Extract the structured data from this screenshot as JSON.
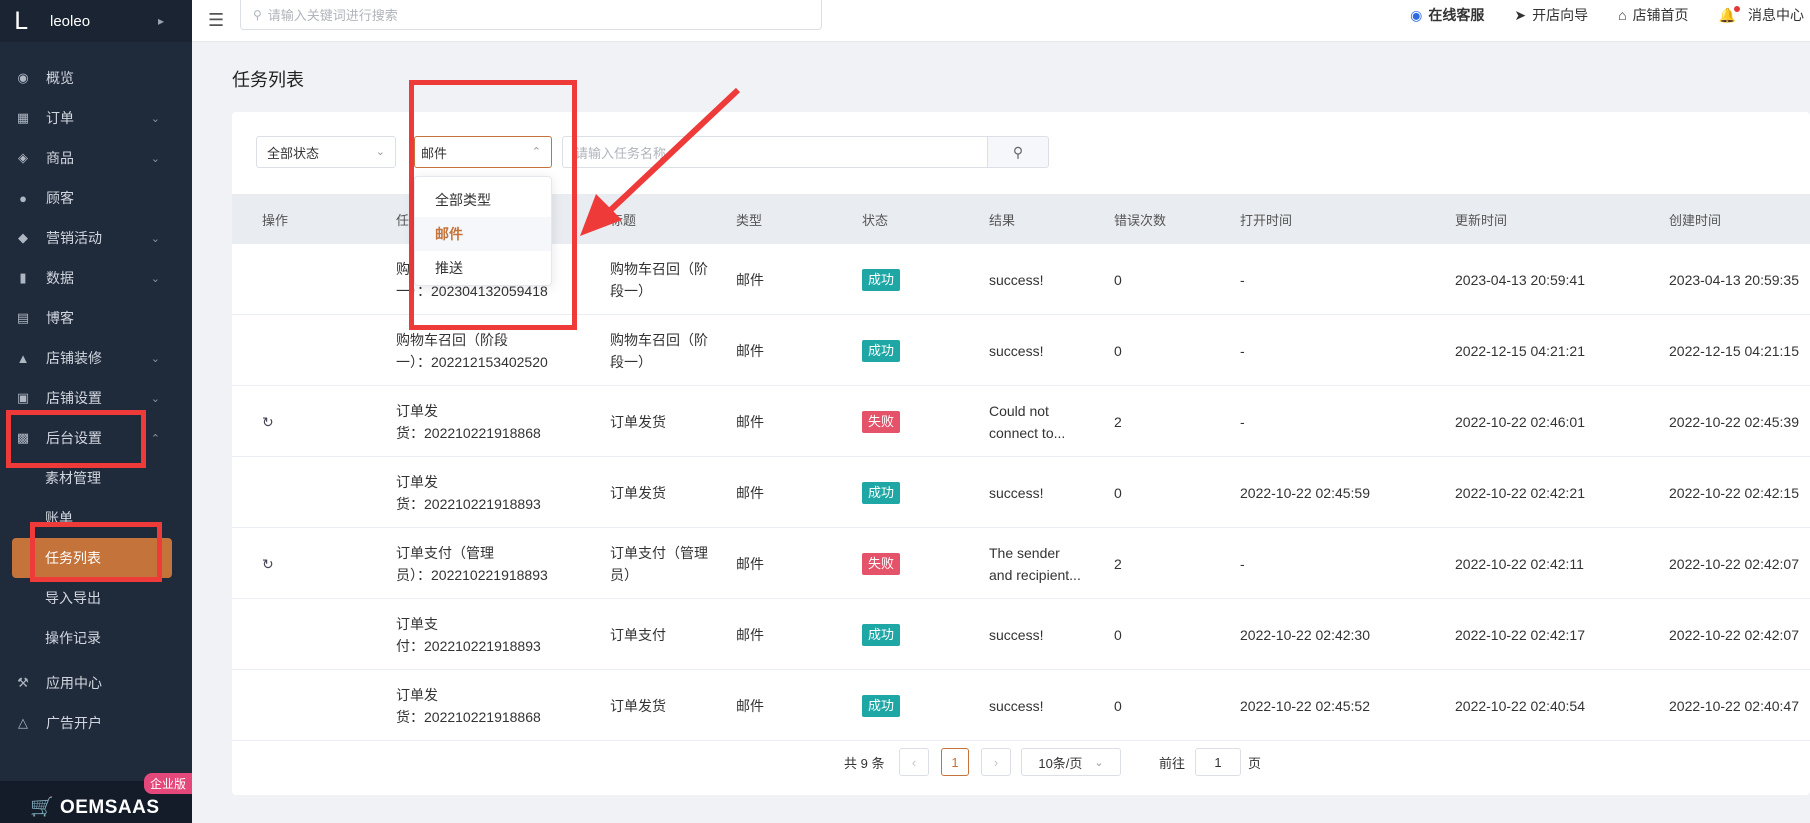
{
  "sidebar": {
    "brand_initial": "L",
    "brand_name": "leoleo",
    "items": [
      {
        "label": "概览",
        "icon": "dashboard-icon"
      },
      {
        "label": "订单",
        "icon": "order-icon"
      },
      {
        "label": "商品",
        "icon": "product-icon"
      },
      {
        "label": "顾客",
        "icon": "customer-icon"
      },
      {
        "label": "营销活动",
        "icon": "tag-icon"
      },
      {
        "label": "数据",
        "icon": "chart-icon"
      },
      {
        "label": "博客",
        "icon": "blog-icon"
      },
      {
        "label": "店铺装修",
        "icon": "brush-icon"
      },
      {
        "label": "店铺设置",
        "icon": "store-icon"
      },
      {
        "label": "后台设置",
        "icon": "admin-icon"
      }
    ],
    "sub_items": [
      "素材管理",
      "账单",
      "任务列表",
      "导入导出",
      "操作记录"
    ],
    "bottom_items": [
      {
        "label": "应用中心",
        "icon": "wrench-icon"
      },
      {
        "label": "广告开户",
        "icon": "ad-icon"
      }
    ],
    "edition_tag": "企业版",
    "product_logo": "OEMSAAS"
  },
  "topbar": {
    "search_placeholder": "请输入关键词进行搜索",
    "links": [
      "在线客服",
      "开店向导",
      "店铺首页",
      "消息中心"
    ]
  },
  "page": {
    "title": "任务列表"
  },
  "filters": {
    "status": "全部状态",
    "type": "邮件",
    "keyword_placeholder": "请输入任务名称"
  },
  "dropdown": {
    "options": [
      "全部类型",
      "邮件",
      "推送"
    ],
    "selected": "邮件"
  },
  "table": {
    "headers": [
      "操作",
      "任务名称",
      "标题",
      "类型",
      "状态",
      "结果",
      "错误次数",
      "打开时间",
      "更新时间",
      "创建时间"
    ],
    "rows": [
      {
        "retry": false,
        "name_line1": "购物车召回（阶段",
        "name_line2": "一）：202304132059418",
        "title_line1": "购物车召回（阶",
        "title_line2": "段一）",
        "type": "邮件",
        "status": "成功",
        "status_kind": "ok",
        "result_line1": "success!",
        "result_line2": "",
        "errors": "0",
        "open": "-",
        "updated": "2023-04-13 20:59:41",
        "created": "2023-04-13 20:59:35"
      },
      {
        "retry": false,
        "name_line1": "购物车召回（阶段",
        "name_line2": "一）：202212153402520",
        "title_line1": "购物车召回（阶",
        "title_line2": "段一）",
        "type": "邮件",
        "status": "成功",
        "status_kind": "ok",
        "result_line1": "success!",
        "result_line2": "",
        "errors": "0",
        "open": "-",
        "updated": "2022-12-15 04:21:21",
        "created": "2022-12-15 04:21:15"
      },
      {
        "retry": true,
        "name_line1": "订单发",
        "name_line2": "货：202210221918868",
        "title_line1": "订单发货",
        "title_line2": "",
        "type": "邮件",
        "status": "失败",
        "status_kind": "fail",
        "result_line1": "Could not",
        "result_line2": "connect to...",
        "errors": "2",
        "open": "-",
        "updated": "2022-10-22 02:46:01",
        "created": "2022-10-22 02:45:39"
      },
      {
        "retry": false,
        "name_line1": "订单发",
        "name_line2": "货：202210221918893",
        "title_line1": "订单发货",
        "title_line2": "",
        "type": "邮件",
        "status": "成功",
        "status_kind": "ok",
        "result_line1": "success!",
        "result_line2": "",
        "errors": "0",
        "open": "2022-10-22 02:45:59",
        "updated": "2022-10-22 02:42:21",
        "created": "2022-10-22 02:42:15"
      },
      {
        "retry": true,
        "name_line1": "订单支付（管理",
        "name_line2": "员）：202210221918893",
        "title_line1": "订单支付（管理",
        "title_line2": "员）",
        "type": "邮件",
        "status": "失败",
        "status_kind": "fail",
        "result_line1": "The sender",
        "result_line2": "and recipient...",
        "errors": "2",
        "open": "-",
        "updated": "2022-10-22 02:42:11",
        "created": "2022-10-22 02:42:07"
      },
      {
        "retry": false,
        "name_line1": "订单支",
        "name_line2": "付：202210221918893",
        "title_line1": "订单支付",
        "title_line2": "",
        "type": "邮件",
        "status": "成功",
        "status_kind": "ok",
        "result_line1": "success!",
        "result_line2": "",
        "errors": "0",
        "open": "2022-10-22 02:42:30",
        "updated": "2022-10-22 02:42:17",
        "created": "2022-10-22 02:42:07"
      },
      {
        "retry": false,
        "name_line1": "订单发",
        "name_line2": "货：202210221918868",
        "title_line1": "订单发货",
        "title_line2": "",
        "type": "邮件",
        "status": "成功",
        "status_kind": "ok",
        "result_line1": "success!",
        "result_line2": "",
        "errors": "0",
        "open": "2022-10-22 02:45:52",
        "updated": "2022-10-22 02:40:54",
        "created": "2022-10-22 02:40:47"
      }
    ]
  },
  "pagination": {
    "total_text": "共 9 条",
    "current_page": "1",
    "page_size": "10条/页",
    "goto_label": "前往",
    "goto_value": "1",
    "page_unit": "页"
  },
  "colors": {
    "sidebar_bg": "#1f2a3b",
    "accent": "#c4733a",
    "success": "#1ea7a5",
    "fail": "#e5536a",
    "annotation": "#ef3a3a"
  }
}
